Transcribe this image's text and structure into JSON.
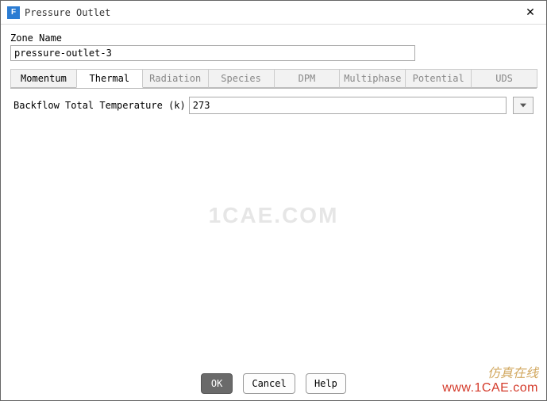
{
  "window": {
    "icon_letter": "F",
    "title": "Pressure Outlet"
  },
  "zone": {
    "label": "Zone Name",
    "value": "pressure-outlet-3"
  },
  "tabs": [
    {
      "label": "Momentum",
      "enabled": true,
      "active": false
    },
    {
      "label": "Thermal",
      "enabled": true,
      "active": true
    },
    {
      "label": "Radiation",
      "enabled": false,
      "active": false
    },
    {
      "label": "Species",
      "enabled": false,
      "active": false
    },
    {
      "label": "DPM",
      "enabled": false,
      "active": false
    },
    {
      "label": "Multiphase",
      "enabled": false,
      "active": false
    },
    {
      "label": "Potential",
      "enabled": false,
      "active": false
    },
    {
      "label": "UDS",
      "enabled": false,
      "active": false
    }
  ],
  "thermal": {
    "backflow_temp_label": "Backflow Total Temperature (k)",
    "backflow_temp_value": "273"
  },
  "buttons": {
    "ok": "OK",
    "cancel": "Cancel",
    "help": "Help"
  },
  "watermark": {
    "center": "1CAE.COM",
    "corner_cn": "仿真在线",
    "corner_url": "www.1CAE.com"
  }
}
